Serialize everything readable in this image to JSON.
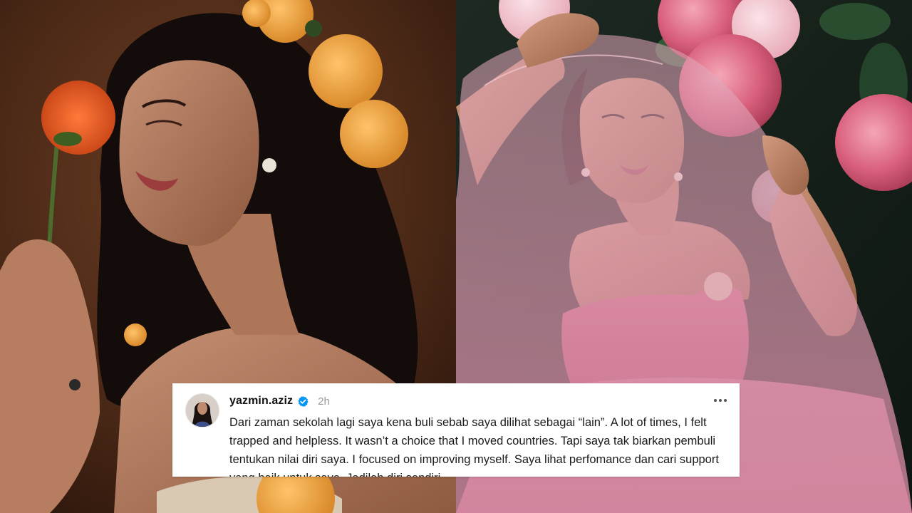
{
  "post": {
    "username": "yazmin.aziz",
    "time": "2h",
    "body": "Dari zaman sekolah lagi saya kena buli sebab saya dilihat sebagai “lain”. A lot of times, I felt trapped and helpless. It wasn’t a choice that I moved countries. Tapi saya tak biarkan pembuli tentukan nilai diri saya. I focused on improving myself. Saya lihat perfomance dan cari support yang baik untuk saya. Jadilah diri sendiri."
  },
  "icons": {
    "verified": "verified-badge-icon",
    "more": "more-options-icon"
  },
  "colors": {
    "verified_badge": "#0095f6",
    "card_background": "#ffffff",
    "timestamp": "#9a9a9a"
  }
}
